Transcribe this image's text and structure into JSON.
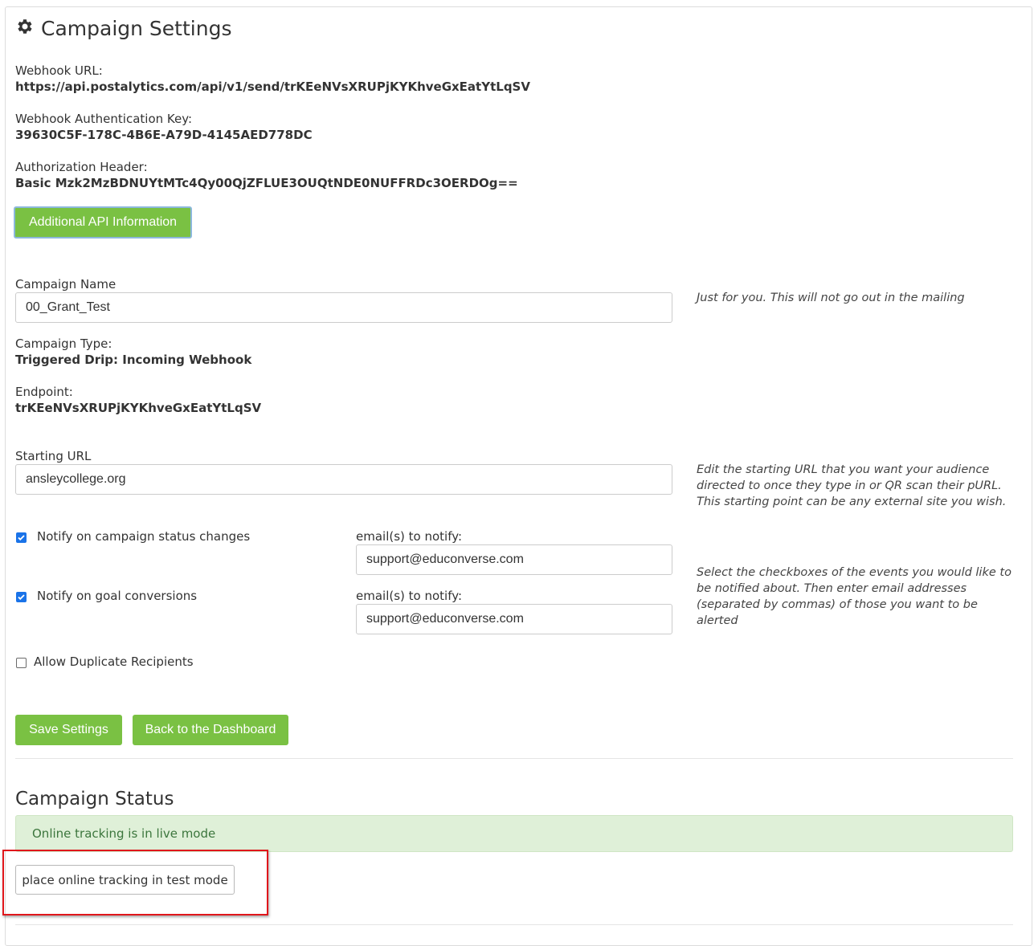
{
  "header": {
    "title": "Campaign Settings",
    "icon": "gear-icon"
  },
  "webhook": {
    "url_label": "Webhook URL:",
    "url_value": "https://api.postalytics.com/api/v1/send/trKEeNVsXRUPjKYKhveGxEatYtLqSV",
    "auth_key_label": "Webhook Authentication Key:",
    "auth_key_value": "39630C5F-178C-4B6E-A79D-4145AED778DC",
    "auth_header_label": "Authorization Header:",
    "auth_header_value": "Basic Mzk2MzBDNUYtMTc4Qy00QjZFLUE3OUQtNDE0NUFFRDc3OERDOg==",
    "api_info_button": "Additional API Information"
  },
  "campaign": {
    "name_label": "Campaign Name",
    "name_value": "00_Grant_Test",
    "name_help": "Just for you. This will not go out in the mailing",
    "type_label": "Campaign Type:",
    "type_value": "Triggered Drip: Incoming Webhook",
    "endpoint_label": "Endpoint:",
    "endpoint_value": "trKEeNVsXRUPjKYKhveGxEatYtLqSV",
    "starting_url_label": "Starting URL",
    "starting_url_value": "ansleycollege.org",
    "starting_url_help": "Edit the starting URL that you want your audience directed to once they type in or QR scan their pURL. This starting point can be any external site you wish."
  },
  "notifications": {
    "status_label": "Notify on campaign status changes",
    "status_checked": true,
    "status_email_label": "email(s) to notify:",
    "status_email_value": "support@educonverse.com",
    "goal_label": "Notify on goal conversions",
    "goal_checked": true,
    "goal_email_label": "email(s) to notify:",
    "goal_email_value": "support@educonverse.com",
    "help": "Select the checkboxes of the events you would like to be notified about. Then enter email addresses (separated by commas) of those you want to be alerted",
    "duplicates_label": "Allow Duplicate Recipients",
    "duplicates_checked": false
  },
  "actions": {
    "save_button": "Save Settings",
    "dashboard_button": "Back to the Dashboard"
  },
  "status_section": {
    "title": "Campaign Status",
    "alert_text": "Online tracking is in live mode",
    "test_mode_button": "place online tracking in test mode"
  },
  "colors": {
    "button_green": "#7ac143",
    "alert_bg": "#dff0d8",
    "alert_text": "#3c763d",
    "checkbox_blue": "#1a73e8",
    "highlight_red": "#e0161b"
  }
}
